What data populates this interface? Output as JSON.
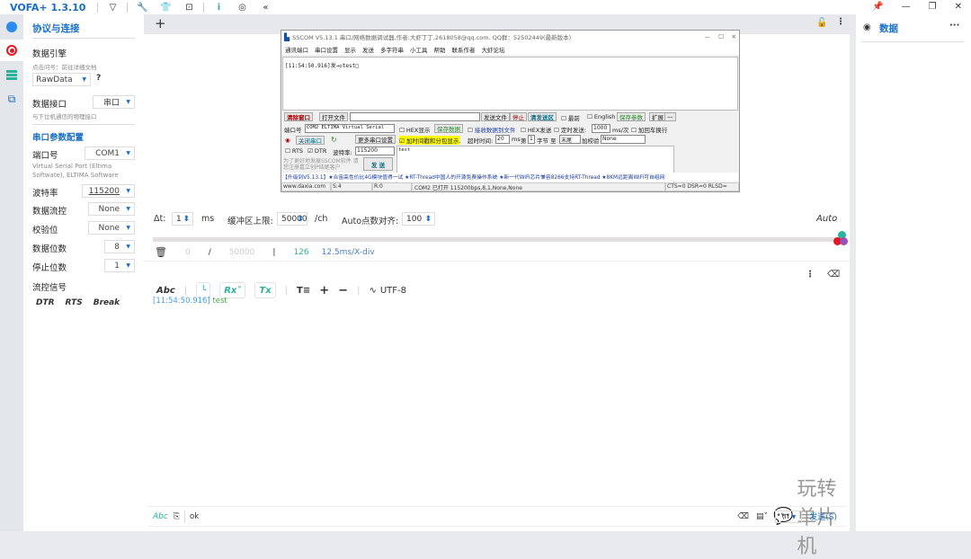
{
  "app": {
    "title": "VOFA+ 1.3.10",
    "toolbar_icons": [
      "vofa-logo-icon",
      "wrench-icon",
      "shirt-icon",
      "screenshot-icon",
      "info-icon",
      "fingerprint-icon",
      "collapse-icon"
    ]
  },
  "sidebar": {
    "items": [
      "connection-icon",
      "record-icon",
      "data-list-icon",
      "windows-icon"
    ]
  },
  "left": {
    "title": "协议与连接",
    "engine_label": "数据引擎",
    "engine_hint": "点击问号：前往详细文档",
    "engine_value": "RawData",
    "help": "?",
    "iface_label": "数据接口",
    "iface_value": "串口",
    "iface_hint": "与下位机通信的物理接口",
    "serial_title": "串口参数配置",
    "port_label": "端口号",
    "port_value": "COM1",
    "port_desc": "Virtual Serial Port (Eltima Softwate), ELTIMA Software",
    "baud_label": "波特率",
    "baud_value": "115200",
    "flow_label": "数据流控",
    "flow_value": "None",
    "parity_label": "校验位",
    "parity_value": "None",
    "databits_label": "数据位数",
    "databits_value": "8",
    "stopbits_label": "停止位数",
    "stopbits_value": "1",
    "signal_label": "流控信号",
    "signals": [
      "DTR",
      "RTS",
      "Break"
    ]
  },
  "main": {
    "add_tab": "+",
    "dt_label": "Δt:",
    "dt_value": "1",
    "dt_unit": "ms",
    "buf_label": "缓冲区上限:",
    "buf_value": "50000",
    "buf_unit": "/ch",
    "align_label": "Auto点数对齐:",
    "align_value": "100",
    "auto_label": "Auto",
    "stats": {
      "count": "0",
      "slash": "/",
      "limit": "50000",
      "bar": "|",
      "points": "126",
      "scale": "12.5ms/X-div"
    },
    "toolbar": {
      "abc": "Abc",
      "rx": "Rx",
      "tx": "Tx",
      "plus": "+",
      "minus": "−",
      "encoding": "UTF-8"
    },
    "log": [
      {
        "time": "[11:54:50.916]",
        "text": "test"
      }
    ],
    "input": {
      "abc": "Abc",
      "value": "ok",
      "newline": "\\n",
      "send": "发送(S)"
    },
    "watermark": "玩转单片机",
    "colors": {
      "ch1": "#2bb39a",
      "ch2": "#e8141e",
      "ch3": "#9b4dba"
    }
  },
  "right": {
    "title": "数据",
    "more": "···"
  },
  "sscom": {
    "title": "SSCOM V5.13.1 串口/网络数据调试器,作者:大虾丁丁,2618058@qq.com. QQ群：52502449(最新版本)",
    "menu": [
      "通讯端口",
      "串口设置",
      "显示",
      "发送",
      "多字符串",
      "小工具",
      "帮助",
      "联系作者",
      "大虾论坛"
    ],
    "recv": "[11:54:50.916]发→◇test□",
    "row1": {
      "clear": "清除窗口",
      "open": "打开文件",
      "sendfile": "发送文件",
      "stop": "停止",
      "clearsend": "清发送区",
      "top": "最前",
      "english": "English",
      "save": "保存参数",
      "expand": "扩展",
      "min": "—"
    },
    "port_label": "端口号",
    "port_value": "COM2 ELTIMA Virtual Serial",
    "close_port": "关闭串口",
    "more_settings": "更多串口设置",
    "rts": "RTS",
    "dtr": "DTR",
    "baud_label": "波特率:",
    "baud_value": "115200",
    "promo": "为了更好地发展SSCOM软件 请您注册嘉立创P结尾客户",
    "send": "发 送",
    "hex_show": "HEX显示",
    "save_data": "保存数据",
    "recv_to_file": "接收数据到文件",
    "hex_send": "HEX发送",
    "timed_send": "定时发送:",
    "interval": "1000",
    "interval_unit": "ms/次",
    "add_crlf": "加回车换行",
    "timestamp": "加时间戳和分包显示.",
    "timeout_label": "超时时间:",
    "timeout": "20",
    "timeout_unit": "ms",
    "byte_from": "第",
    "byte_idx": "1",
    "byte_to": "字节 至",
    "byte_end": "末尾",
    "checksum": "加校验",
    "checksum_value": "None",
    "send_text": "test",
    "ticker": "【升级到V5.13.1】★合宙高性价比4G模块值得一试 ★RT-Thread中国人的开源免费操作系统 ★新一代WiFi芯片兼容8266支持RT-Thread ★8KM远距离WiFi可自组网",
    "status": [
      "www.daxia.com",
      "S:4",
      "R:0",
      "COM2 已打开  115200bps,8,1,None,None",
      "CTS=0 DSR=0 RLSD="
    ]
  }
}
